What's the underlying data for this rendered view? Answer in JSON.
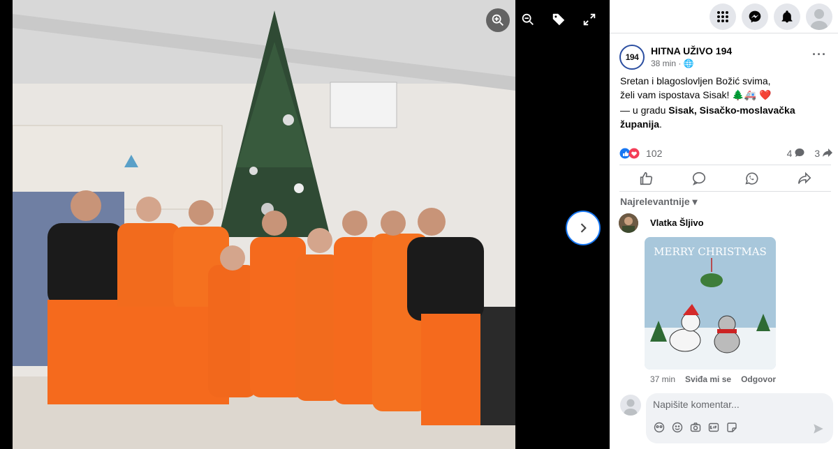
{
  "viewer": {
    "controls": {
      "zoom_in_icon": "zoom-in-icon",
      "zoom_out_icon": "zoom-out-icon",
      "tag_icon": "tag-icon",
      "fullscreen_icon": "expand-icon",
      "next_icon": "chevron-right-icon"
    }
  },
  "header": {
    "icons": [
      "grid-menu-icon",
      "messenger-icon",
      "bell-icon",
      "account-avatar"
    ]
  },
  "post": {
    "page_logo_text": "194",
    "page_name": "HITNA UŽIVO 194",
    "time": "38 min · 🌐",
    "text_line1": "Sretan i blagoslovljen Božić svima,",
    "text_line2": "želi vam ispostava Sisak! 🌲🚑 ❤️",
    "location_prefix": "— u gradu ",
    "location_bold_1": "Sisak, Sisačko-moslavačka",
    "location_bold_2": "županija",
    "location_suffix": ".",
    "reactions_count": "102",
    "comments_count": "4",
    "shares_count": "3",
    "sort_label": "Najrelevantnije ▾"
  },
  "comment": {
    "author": "Vlatka Šljivo",
    "sticker_text": "MERRY CHRISTMAS",
    "time": "37 min",
    "like_label": "Sviđa mi se",
    "reply_label": "Odgovor"
  },
  "composer": {
    "placeholder": "Napišite komentar..."
  },
  "colors": {
    "accent": "#1877f2",
    "muted": "#65676b"
  }
}
